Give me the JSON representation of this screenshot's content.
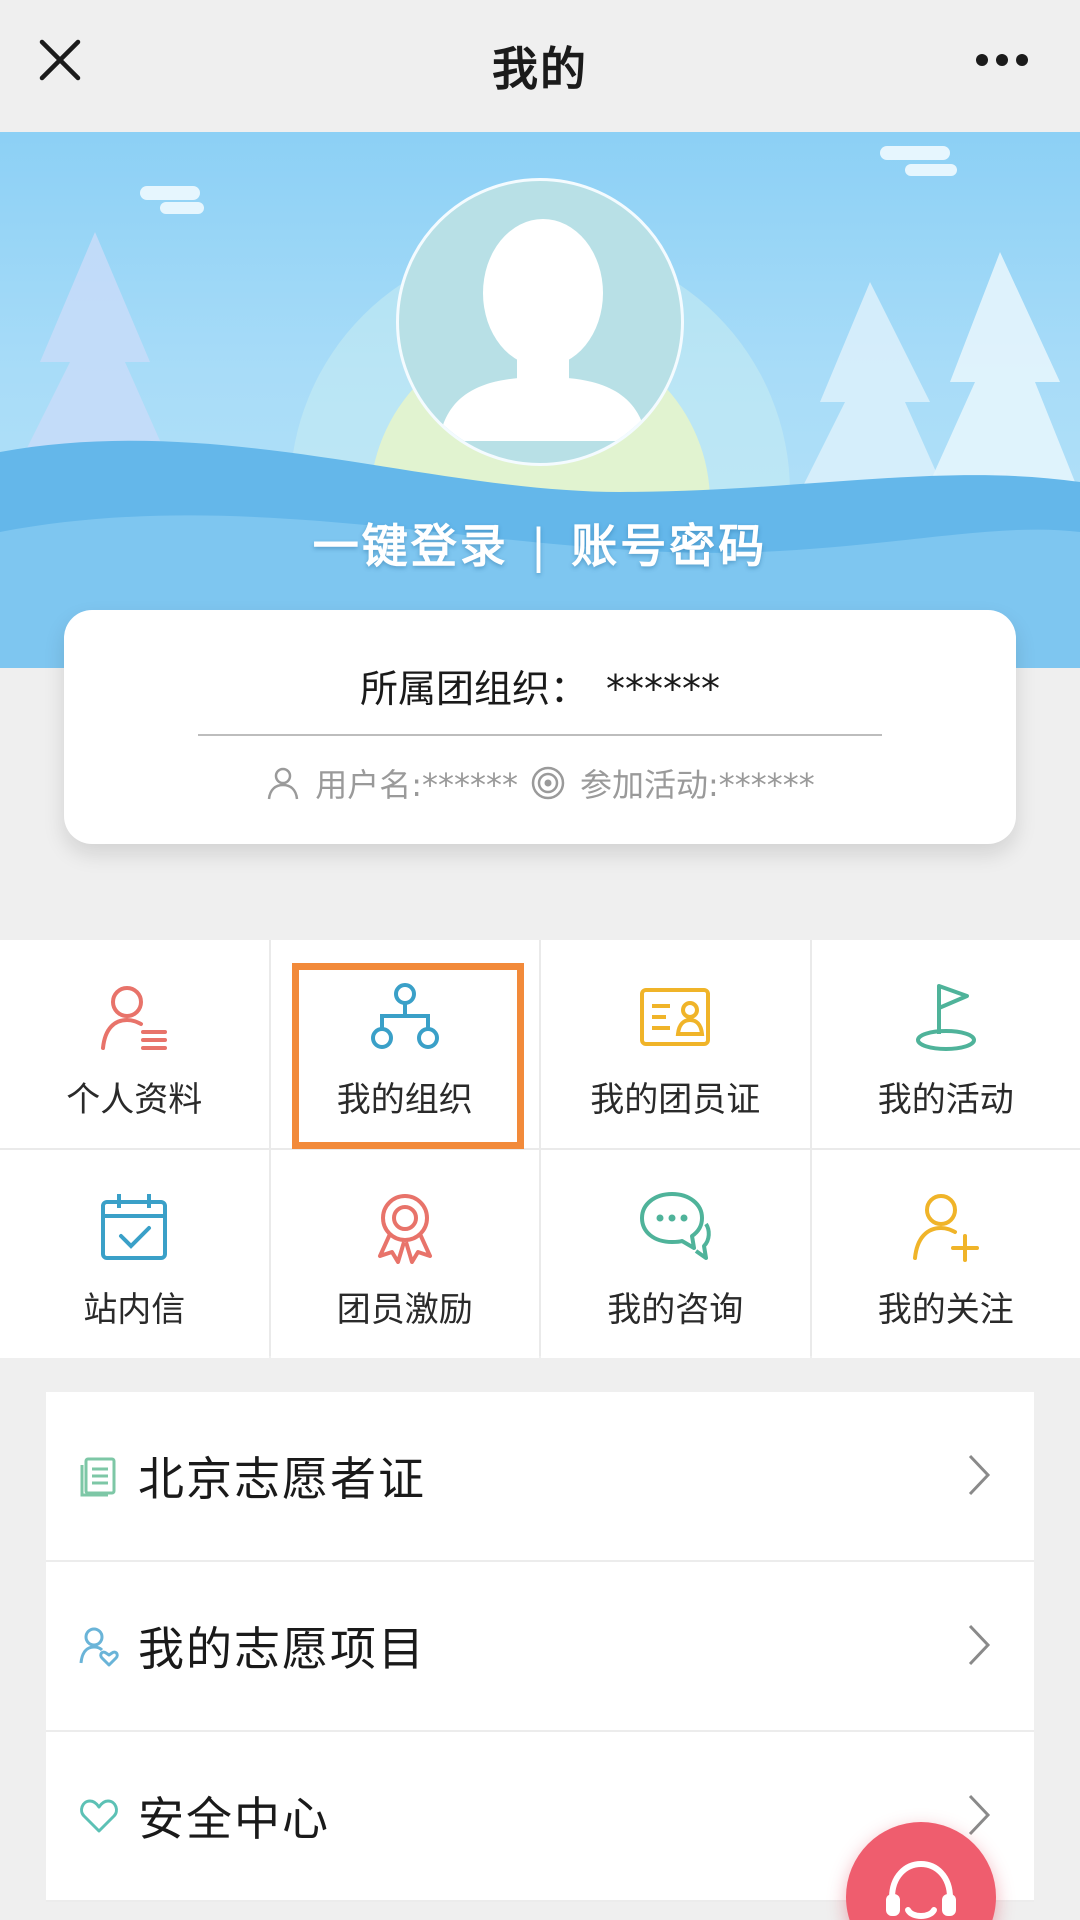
{
  "navbar": {
    "title": "我的"
  },
  "hero": {
    "login_one_click": "一键登录",
    "separator": "|",
    "login_password": "账号密码"
  },
  "info_card": {
    "org_label": "所属团组织：",
    "org_value": "******",
    "username": "用户名:******",
    "activities": "参加活动:******"
  },
  "grid": {
    "items": [
      {
        "label": "个人资料",
        "icon": "profile-icon",
        "color": "#e8736a"
      },
      {
        "label": "我的组织",
        "icon": "organization-icon",
        "color": "#3aa0c8"
      },
      {
        "label": "我的团员证",
        "icon": "member-card-icon",
        "color": "#f0b429"
      },
      {
        "label": "我的活动",
        "icon": "flag-icon",
        "color": "#4fb39a"
      },
      {
        "label": "站内信",
        "icon": "calendar-message-icon",
        "color": "#3aa0c8"
      },
      {
        "label": "团员激励",
        "icon": "award-ribbon-icon",
        "color": "#e8736a"
      },
      {
        "label": "我的咨询",
        "icon": "chat-bubbles-icon",
        "color": "#4fb39a"
      },
      {
        "label": "我的关注",
        "icon": "follow-user-icon",
        "color": "#f0b429"
      }
    ],
    "highlight_color": "#f28a3a"
  },
  "list": {
    "items": [
      {
        "label": "北京志愿者证",
        "icon": "document-icon"
      },
      {
        "label": "我的志愿项目",
        "icon": "volunteer-user-icon"
      },
      {
        "label": "安全中心",
        "icon": "heart-icon"
      }
    ]
  },
  "colors": {
    "fab": "#ef5d6e",
    "sky": "#8cd0f5"
  }
}
